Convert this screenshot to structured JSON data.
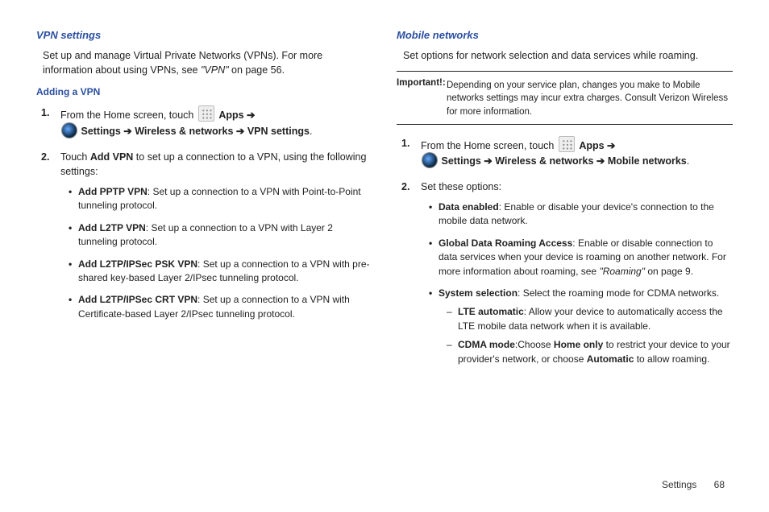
{
  "left": {
    "title": "VPN settings",
    "intro_a": "Set up and manage Virtual Private Networks (VPNs).  For more information about using VPNs, see ",
    "intro_ref": "\"VPN\"",
    "intro_b": " on page 56.",
    "subhead": "Adding a VPN",
    "step1_a": "From the Home screen, touch ",
    "step1_apps": "Apps",
    "step1_settings": "Settings",
    "step1_wireless": "Wireless & networks",
    "step1_vpn": "VPN settings",
    "step2_a": "Touch ",
    "step2_b": "Add VPN",
    "step2_c": " to set up a connection to a VPN, using the following settings:",
    "b1_t": "Add PPTP VPN",
    "b1_d": ": Set up a connection to a VPN with Point-to-Point tunneling protocol.",
    "b2_t": "Add L2TP VPN",
    "b2_d": ": Set up a connection to a VPN with Layer 2 tunneling protocol.",
    "b3_t": "Add L2TP/IPSec PSK VPN",
    "b3_d": ": Set up a connection to a VPN with pre-shared key-based Layer 2/IPsec tunneling protocol.",
    "b4_t": "Add L2TP/IPSec CRT VPN",
    "b4_d": ": Set up a connection to a VPN with Certificate-based Layer 2/IPsec tunneling protocol."
  },
  "right": {
    "title": "Mobile networks",
    "intro": "Set options for network selection and data services while roaming.",
    "important_label": "Important!:",
    "important_body": "Depending on your service plan, changes you make to Mobile networks settings may incur extra charges. Consult Verizon Wireless for more information.",
    "step1_a": "From the Home screen, touch ",
    "step1_apps": "Apps",
    "step1_settings": "Settings",
    "step1_wireless": "Wireless & networks",
    "step1_mobile": "Mobile networks",
    "step2": "Set these options:",
    "b1_t": "Data enabled",
    "b1_d": ": Enable or disable your device's connection  to the mobile data network.",
    "b2_t": "Global Data Roaming Access",
    "b2_d1": ": Enable or disable connection to data services when your device is roaming on another network. For more information about roaming, see ",
    "b2_ref": "\"Roaming\"",
    "b2_d2": " on page 9.",
    "b3_t": "System selection",
    "b3_d": ": Select the roaming mode for CDMA networks.",
    "d1_t": "LTE automatic",
    "d1_d": ": Allow your device to automatically access the LTE mobile data network when it is available.",
    "d2_t": "CDMA mode",
    "d2_a": ":Choose ",
    "d2_home": "Home only",
    "d2_b": " to restrict your device to your provider's network, or choose ",
    "d2_auto": "Automatic",
    "d2_c": " to allow roaming."
  },
  "footer": {
    "section": "Settings",
    "page": "68"
  }
}
